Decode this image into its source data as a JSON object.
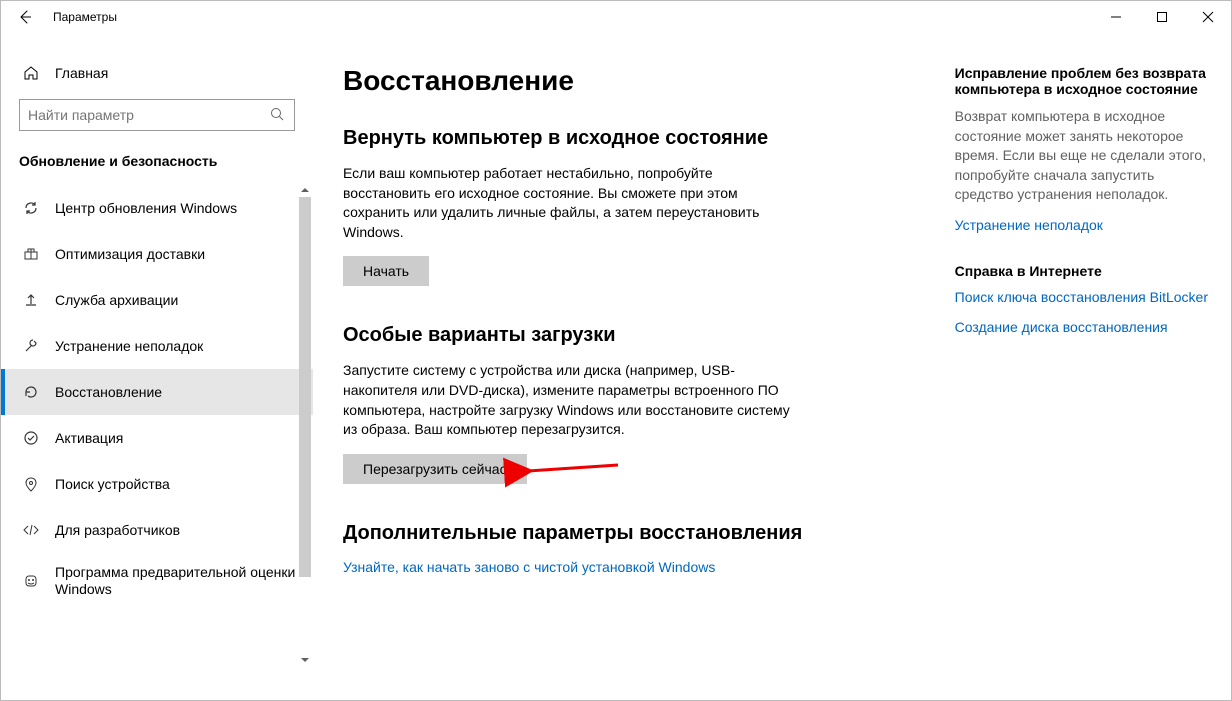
{
  "window": {
    "title": "Параметры"
  },
  "sidebar": {
    "home": "Главная",
    "search_placeholder": "Найти параметр",
    "section": "Обновление и безопасность",
    "items": [
      {
        "label": "Центр обновления Windows"
      },
      {
        "label": "Оптимизация доставки"
      },
      {
        "label": "Служба архивации"
      },
      {
        "label": "Устранение неполадок"
      },
      {
        "label": "Восстановление"
      },
      {
        "label": "Активация"
      },
      {
        "label": "Поиск устройства"
      },
      {
        "label": "Для разработчиков"
      },
      {
        "label": "Программа предварительной оценки Windows"
      }
    ]
  },
  "main": {
    "page_title": "Восстановление",
    "reset": {
      "heading": "Вернуть компьютер в исходное состояние",
      "desc": "Если ваш компьютер работает нестабильно, попробуйте восстановить его исходное состояние. Вы сможете при этом сохранить или удалить личные файлы, а затем переустановить Windows.",
      "button": "Начать"
    },
    "advanced_startup": {
      "heading": "Особые варианты загрузки",
      "desc": "Запустите систему с устройства или диска (например, USB-накопителя или DVD-диска), измените параметры встроенного ПО компьютера, настройте загрузку Windows или восстановите систему из образа. Ваш компьютер перезагрузится.",
      "button": "Перезагрузить сейчас"
    },
    "more": {
      "heading": "Дополнительные параметры восстановления",
      "link": "Узнайте, как начать заново с чистой установкой Windows"
    }
  },
  "aside": {
    "fix": {
      "heading": "Исправление проблем без возврата компьютера в исходное состояние",
      "text": "Возврат компьютера в исходное состояние может занять некоторое время. Если вы еще не сделали этого, попробуйте сначала запустить средство устранения неполадок.",
      "link": "Устранение неполадок"
    },
    "help": {
      "heading": "Справка в Интернете",
      "links": [
        "Поиск ключа восстановления BitLocker",
        "Создание диска восстановления"
      ]
    }
  }
}
